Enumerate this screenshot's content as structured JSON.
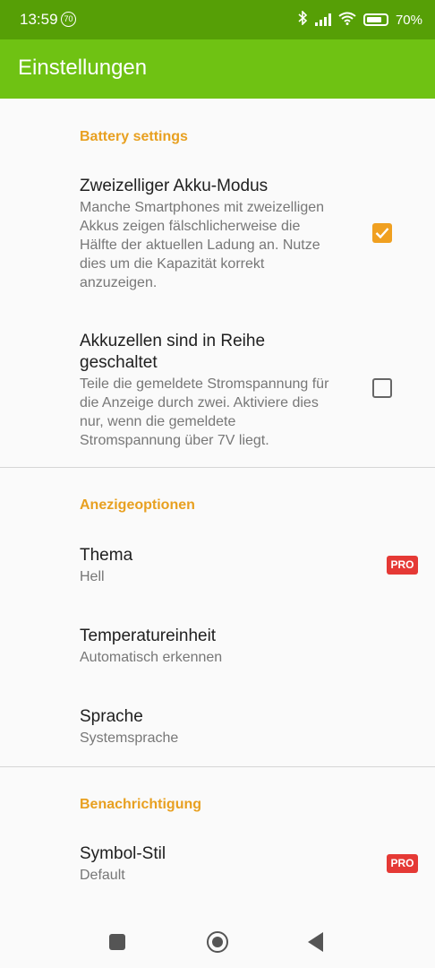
{
  "status_bar": {
    "time": "13:59",
    "notification_badge": "70",
    "battery_percent": "70%",
    "icons": [
      "bluetooth-icon",
      "signal-icon",
      "wifi-icon",
      "battery-icon"
    ]
  },
  "app_bar": {
    "title": "Einstellungen"
  },
  "sections": [
    {
      "title": "Battery settings",
      "items": [
        {
          "title": "Zweizelliger Akku-Modus",
          "description": "Manche Smartphones mit zweizelligen Akkus zeigen fälschlicherweise die Hälfte der aktuellen Ladung an. Nutze dies um die Kapazität korrekt anzuzeigen.",
          "checked": true
        },
        {
          "title": "Akkuzellen sind in Reihe geschaltet",
          "description": "Teile die gemeldete Stromspannung für die Anzeige durch zwei. Aktiviere dies nur, wenn die gemeldete Stromspannung über 7V liegt.",
          "checked": false
        }
      ]
    },
    {
      "title": "Anezigeoptionen",
      "items": [
        {
          "title": "Thema",
          "summary": "Hell",
          "badge": "PRO"
        },
        {
          "title": "Temperatureinheit",
          "summary": "Automatisch erkennen"
        },
        {
          "title": "Sprache",
          "summary": "Systemsprache"
        }
      ]
    },
    {
      "title": "Benachrichtigung",
      "items": [
        {
          "title": "Symbol-Stil",
          "summary": "Default",
          "badge": "PRO"
        }
      ]
    }
  ],
  "colors": {
    "status_bar": "#569f06",
    "app_bar": "#6fc213",
    "section_title": "#e8a020",
    "checkbox_on": "#f0a020",
    "pro_badge": "#e53935"
  }
}
